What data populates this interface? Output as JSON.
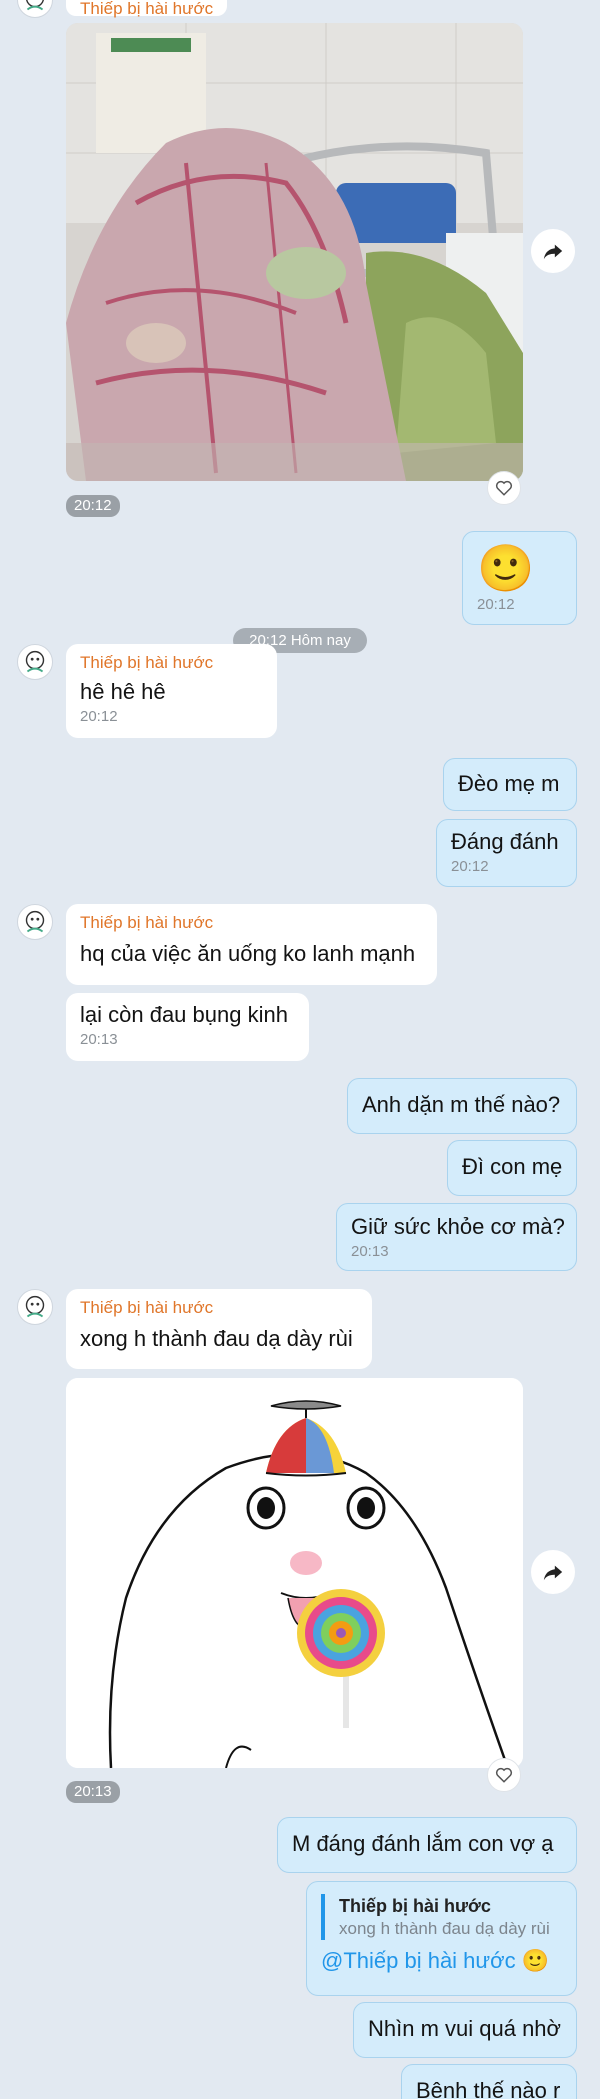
{
  "sender_name": "Thiếp bị hài hước",
  "messages": {
    "photo1_time": "20:12",
    "out_emoji": "🙂",
    "out_emoji_time": "20:12",
    "divider": "20:12 Hôm nay",
    "in1_text": "hê hê hê",
    "in1_time": "20:12",
    "out1_text": "Đèo mẹ m",
    "out2_text": "Đáng đánh",
    "out2_time": "20:12",
    "in2_text": "hq của việc ăn uống ko lanh mạnh",
    "in3_text": "lại còn đau bụng kinh",
    "in3_time": "20:13",
    "out3_text": "Anh dặn m thế nào?",
    "out4_text": "Đì con mẹ",
    "out5_text": "Giữ sức khỏe cơ mà?",
    "out5_time": "20:13",
    "in4_text": "xong h thành đau dạ dày rùi",
    "photo2_time": "20:13",
    "out6_text": "M đáng đánh lắm con vợ ạ",
    "reply_quote_title": "Thiếp bị hài hước",
    "reply_quote_text": "xong h thành đau dạ dày rùi",
    "reply_mention": "@Thiếp bị hài hước 🙂",
    "out7_text": "Nhìn m vui quá nhờ",
    "out8_text": "Bệnh thế nào r"
  },
  "colors": {
    "background": "#e2e9f1",
    "incoming_bubble": "#ffffff",
    "outgoing_bubble": "#d4ecfb",
    "sender_name": "#e0762a",
    "mention": "#2196e9"
  },
  "icons": [
    "avatar-icon",
    "share-icon",
    "heart-icon"
  ]
}
